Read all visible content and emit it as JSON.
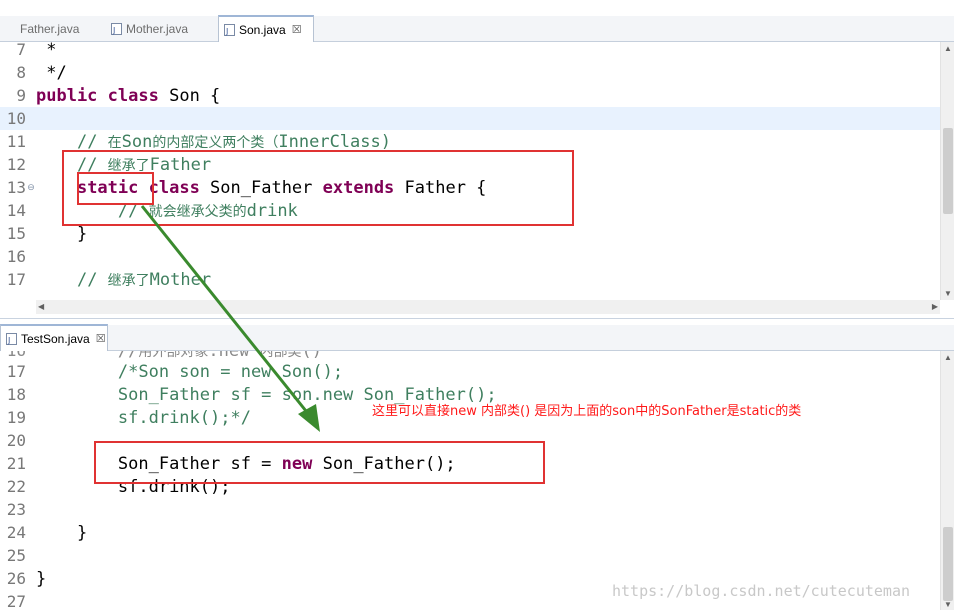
{
  "top_tabs": [
    {
      "label": "Father.java",
      "active": false
    },
    {
      "label": "Mother.java",
      "active": false
    },
    {
      "label": "Son.java",
      "active": true,
      "close": "☒"
    }
  ],
  "bottom_tabs": [
    {
      "label": "TestSon.java",
      "active": true,
      "close": "☒"
    }
  ],
  "top_editor": {
    "lines": [
      {
        "num": "7",
        "code": " *"
      },
      {
        "num": "8",
        "code": " */"
      },
      {
        "num": "9",
        "kw1": "public",
        "kw2": "class",
        "rest": " Son {"
      },
      {
        "num": "10"
      },
      {
        "num": "11",
        "indent": "    ",
        "cm_pre": "// ",
        "cm_cjk1": "在",
        "cm_mid": "Son",
        "cm_cjk2": "的内部定义两个类（",
        "cm_post": "InnerClass)"
      },
      {
        "num": "12",
        "indent": "    ",
        "cm_pre": "// ",
        "cm_cjk": "继承了",
        "cm_post": "Father"
      },
      {
        "num": "13",
        "fold": "⊖",
        "indent": "    ",
        "kw1": "static",
        "kw2": "class",
        "mid": " Son_Father ",
        "kw3": "extends",
        "rest": " Father {"
      },
      {
        "num": "14",
        "indent": "        ",
        "cm_pre": "// ",
        "cm_cjk": "就会继承父类的",
        "cm_post": "drink"
      },
      {
        "num": "15",
        "code": "    }"
      },
      {
        "num": "16"
      },
      {
        "num": "17",
        "indent": "    ",
        "cm_pre": "// ",
        "cm_cjk": "继承了",
        "cm_post": "Mother"
      }
    ]
  },
  "bottom_editor": {
    "lines": [
      {
        "num": "17",
        "indent": "        ",
        "code": "/*Son son = new Son();"
      },
      {
        "num": "18",
        "indent": "        ",
        "code": "Son_Father sf = son.new Son_Father();"
      },
      {
        "num": "19",
        "indent": "        ",
        "code": "sf.drink();*/"
      },
      {
        "num": "20"
      },
      {
        "num": "21",
        "indent": "        ",
        "pre": "Son_Father sf = ",
        "kw": "new",
        "post": " Son_Father();"
      },
      {
        "num": "22",
        "indent": "        ",
        "code": "sf.drink();"
      },
      {
        "num": "23"
      },
      {
        "num": "24",
        "code": "    }"
      },
      {
        "num": "25"
      },
      {
        "num": "26",
        "code": "}"
      },
      {
        "num": "27"
      }
    ]
  },
  "annotation": "这里可以直接new 内部类() 是因为上面的son中的SonFather是static的类",
  "watermark": "https://blog.csdn.net/cutecuteman",
  "colors": {
    "keyword": "#7f0055",
    "comment": "#3f7f5f",
    "highlight_box": "#e03232",
    "arrow": "#3a8a2e",
    "annotation": "#ff1a1a"
  },
  "icons": {
    "java_file": "java-file-icon",
    "close_tab": "close-icon"
  }
}
